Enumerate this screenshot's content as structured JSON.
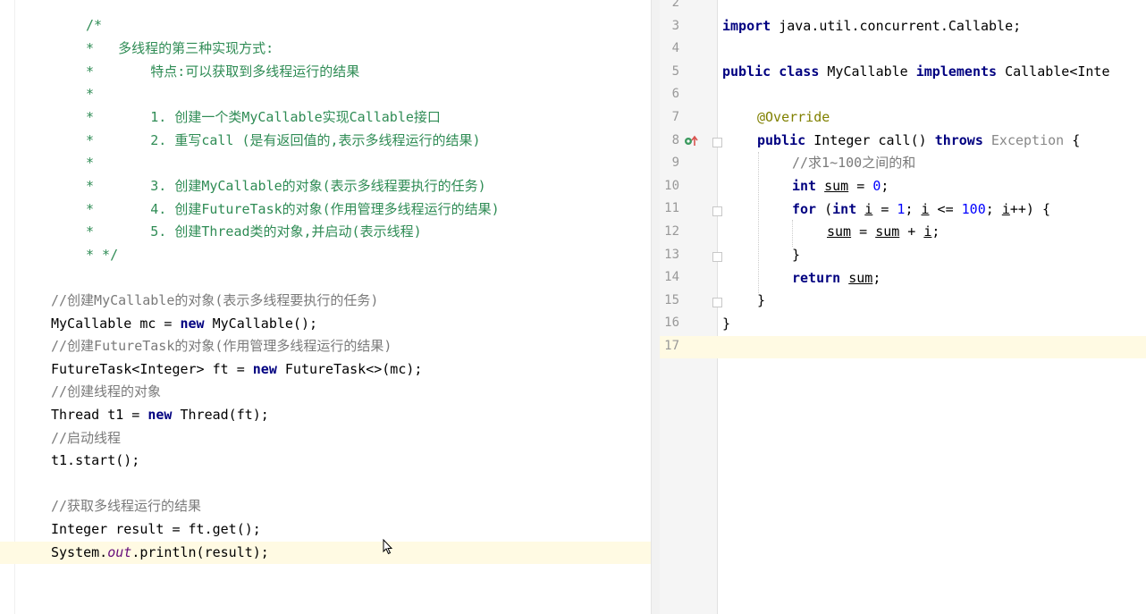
{
  "left_code": {
    "comment_lines": [
      "/*",
      "*   多线程的第三种实现方式:",
      "*       特点:可以获取到多线程运行的结果",
      "*",
      "*       1. 创建一个类MyCallable实现Callable接口",
      "*       2. 重写call (是有返回值的,表示多线程运行的结果)",
      "*",
      "*       3. 创建MyCallable的对象(表示多线程要执行的任务)",
      "*       4. 创建FutureTask的对象(作用管理多线程运行的结果)",
      "*       5. 创建Thread类的对象,并启动(表示线程)",
      "* */"
    ],
    "c1": "//创建MyCallable的对象(表示多线程要执行的任务)",
    "l1a": "MyCallable mc = ",
    "l1kw": "new",
    "l1b": " MyCallable();",
    "c2": "//创建FutureTask的对象(作用管理多线程运行的结果)",
    "l2a": "FutureTask<Integer> ft = ",
    "l2kw": "new",
    "l2b": " FutureTask<>(mc);",
    "c3": "//创建线程的对象",
    "l3a": "Thread t1 = ",
    "l3kw": "new",
    "l3b": " Thread(ft);",
    "c4": "//启动线程",
    "l4": "t1.start();",
    "c5": "//获取多线程运行的结果",
    "l5": "Integer result = ft.get();",
    "l6a": "System.",
    "l6field": "out",
    "l6b": ".println(result);"
  },
  "right_code": {
    "line_numbers": [
      "2",
      "3",
      "4",
      "5",
      "6",
      "7",
      "8",
      "9",
      "10",
      "11",
      "12",
      "13",
      "14",
      "15",
      "16",
      "17"
    ],
    "import_kw": "import",
    "import_rest": " java.util.concurrent.Callable;",
    "class_kw1": "public class",
    "class_name": " MyCallable ",
    "class_kw2": "implements",
    "class_rest": " Callable<Inte",
    "annotation": "@Override",
    "method_kw1": "public",
    "method_mid": " Integer call() ",
    "method_kw2": "throws",
    "method_exc": " Exception",
    "method_end": " {",
    "comment": "//求1~100之间的和",
    "sum_kw": "int",
    "sum_var": "sum",
    "sum_eq": " = ",
    "sum_val": "0",
    "sum_end": ";",
    "for_kw": "for",
    "for_p1": " (",
    "for_int": "int",
    "for_i1": "i",
    "for_eq": " = ",
    "for_v1": "1",
    "for_semi1": "; ",
    "for_i2": "i",
    "for_le": " <= ",
    "for_v2": "100",
    "for_semi2": "; ",
    "for_i3": "i",
    "for_end": "++) {",
    "body_sum1": "sum",
    "body_eq": " = ",
    "body_sum2": "sum",
    "body_plus": " + ",
    "body_i": "i",
    "body_end": ";",
    "close1": "}",
    "return_kw": "return",
    "return_var": "sum",
    "return_end": ";",
    "close2": "}",
    "close3": "}"
  },
  "colors": {
    "keyword": "#000080",
    "number": "#0000ff",
    "annotation": "#808000",
    "comment": "#7a7a7a",
    "doc_comment": "#2f8c55",
    "highlight": "#fffae3"
  }
}
